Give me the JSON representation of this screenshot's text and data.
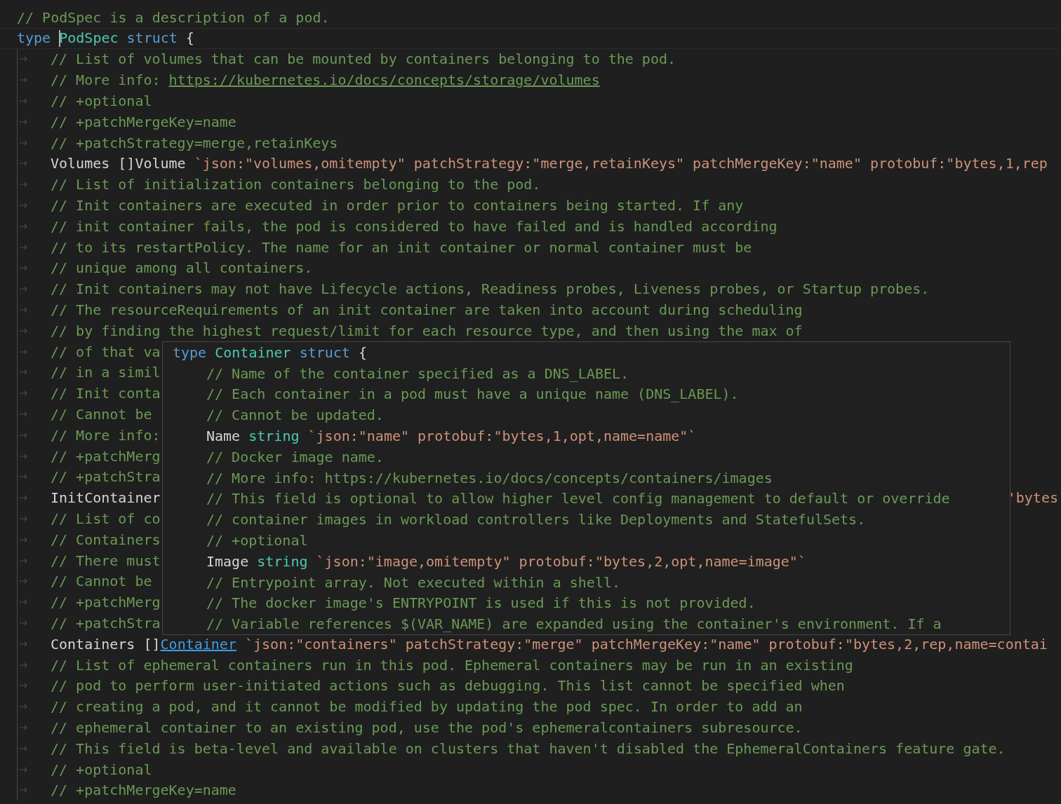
{
  "editor": {
    "lines": [
      {
        "indented": false,
        "tokens": [
          {
            "kind": "comment",
            "text": "// PodSpec is a description of a pod."
          }
        ]
      },
      {
        "indented": false,
        "active": true,
        "tokens": [
          {
            "kind": "keyword",
            "text": "type "
          },
          {
            "kind": "type",
            "text": "PodSpec",
            "caret": true
          },
          {
            "kind": "keyword",
            "text": " struct"
          },
          {
            "kind": "plain",
            "text": " {"
          }
        ]
      },
      {
        "indented": true,
        "tokens": [
          {
            "kind": "comment",
            "text": "// List of volumes that can be mounted by containers belonging to the pod."
          }
        ]
      },
      {
        "indented": true,
        "tokens": [
          {
            "kind": "comment",
            "text": "// More info: "
          },
          {
            "kind": "link",
            "text": "https://kubernetes.io/docs/concepts/storage/volumes"
          }
        ]
      },
      {
        "indented": true,
        "tokens": [
          {
            "kind": "comment",
            "text": "// +optional"
          }
        ]
      },
      {
        "indented": true,
        "tokens": [
          {
            "kind": "comment",
            "text": "// +patchMergeKey=name"
          }
        ]
      },
      {
        "indented": true,
        "tokens": [
          {
            "kind": "comment",
            "text": "// +patchStrategy=merge,retainKeys"
          }
        ]
      },
      {
        "indented": true,
        "tokens": [
          {
            "kind": "plain",
            "text": "Volumes []Volume "
          },
          {
            "kind": "string",
            "text": "`json:\"volumes,omitempty\" patchStrategy:\"merge,retainKeys\" patchMergeKey:\"name\" protobuf:\"bytes,1,rep"
          }
        ]
      },
      {
        "indented": true,
        "tokens": [
          {
            "kind": "comment",
            "text": "// List of initialization containers belonging to the pod."
          }
        ]
      },
      {
        "indented": true,
        "tokens": [
          {
            "kind": "comment",
            "text": "// Init containers are executed in order prior to containers being started. If any"
          }
        ]
      },
      {
        "indented": true,
        "tokens": [
          {
            "kind": "comment",
            "text": "// init container fails, the pod is considered to have failed and is handled according"
          }
        ]
      },
      {
        "indented": true,
        "tokens": [
          {
            "kind": "comment",
            "text": "// to its restartPolicy. The name for an init container or normal container must be"
          }
        ]
      },
      {
        "indented": true,
        "tokens": [
          {
            "kind": "comment",
            "text": "// unique among all containers."
          }
        ]
      },
      {
        "indented": true,
        "tokens": [
          {
            "kind": "comment",
            "text": "// Init containers may not have Lifecycle actions, Readiness probes, Liveness probes, or Startup probes."
          }
        ]
      },
      {
        "indented": true,
        "tokens": [
          {
            "kind": "comment",
            "text": "// The resourceRequirements of an init container are taken into account during scheduling"
          }
        ]
      },
      {
        "indented": true,
        "tokens": [
          {
            "kind": "comment",
            "text": "// by finding the highest request/limit for each resource type, and then using the max of"
          }
        ]
      },
      {
        "indented": true,
        "tokens": [
          {
            "kind": "comment",
            "text": "// of that va"
          }
        ]
      },
      {
        "indented": true,
        "tokens": [
          {
            "kind": "comment",
            "text": "// in a simil"
          }
        ]
      },
      {
        "indented": true,
        "tokens": [
          {
            "kind": "comment",
            "text": "// Init conta"
          }
        ]
      },
      {
        "indented": true,
        "tokens": [
          {
            "kind": "comment",
            "text": "// Cannot be"
          }
        ]
      },
      {
        "indented": true,
        "tokens": [
          {
            "kind": "comment",
            "text": "// More info:"
          }
        ]
      },
      {
        "indented": true,
        "tokens": [
          {
            "kind": "comment",
            "text": "// +patchMerg"
          }
        ]
      },
      {
        "indented": true,
        "tokens": [
          {
            "kind": "comment",
            "text": "// +patchStra"
          }
        ]
      },
      {
        "indented": true,
        "tokens": [
          {
            "kind": "plain",
            "text": "InitContainer"
          }
        ],
        "right_tokens": [
          {
            "kind": "string",
            "text": "'bytes"
          }
        ]
      },
      {
        "indented": true,
        "tokens": [
          {
            "kind": "comment",
            "text": "// List of co"
          }
        ]
      },
      {
        "indented": true,
        "tokens": [
          {
            "kind": "comment",
            "text": "// Containers"
          }
        ]
      },
      {
        "indented": true,
        "tokens": [
          {
            "kind": "comment",
            "text": "// There must"
          }
        ]
      },
      {
        "indented": true,
        "tokens": [
          {
            "kind": "comment",
            "text": "// Cannot be"
          }
        ]
      },
      {
        "indented": true,
        "tokens": [
          {
            "kind": "comment",
            "text": "// +patchMerg"
          }
        ]
      },
      {
        "indented": true,
        "tokens": [
          {
            "kind": "comment",
            "text": "// +patchStra"
          }
        ]
      },
      {
        "indented": true,
        "tokens": [
          {
            "kind": "plain",
            "text": "Containers []"
          },
          {
            "kind": "typelink",
            "text": "Container"
          },
          {
            "kind": "string",
            "text": " `json:\"containers\" patchStrategy:\"merge\" patchMergeKey:\"name\" protobuf:\"bytes,2,rep,name=contai"
          }
        ]
      },
      {
        "indented": true,
        "tokens": [
          {
            "kind": "comment",
            "text": "// List of ephemeral containers run in this pod. Ephemeral containers may be run in an existing"
          }
        ]
      },
      {
        "indented": true,
        "tokens": [
          {
            "kind": "comment",
            "text": "// pod to perform user-initiated actions such as debugging. This list cannot be specified when"
          }
        ]
      },
      {
        "indented": true,
        "tokens": [
          {
            "kind": "comment",
            "text": "// creating a pod, and it cannot be modified by updating the pod spec. In order to add an"
          }
        ]
      },
      {
        "indented": true,
        "tokens": [
          {
            "kind": "comment",
            "text": "// ephemeral container to an existing pod, use the pod's ephemeralcontainers subresource."
          }
        ]
      },
      {
        "indented": true,
        "tokens": [
          {
            "kind": "comment",
            "text": "// This field is beta-level and available on clusters that haven't disabled the EphemeralContainers feature gate."
          }
        ]
      },
      {
        "indented": true,
        "tokens": [
          {
            "kind": "comment",
            "text": "// +optional"
          }
        ]
      },
      {
        "indented": true,
        "tokens": [
          {
            "kind": "comment",
            "text": "// +patchMergeKey=name"
          }
        ]
      }
    ]
  },
  "hover_popup": {
    "lines": [
      {
        "indented": false,
        "tokens": [
          {
            "kind": "keyword",
            "text": "type "
          },
          {
            "kind": "type",
            "text": "Container"
          },
          {
            "kind": "keyword",
            "text": " struct"
          },
          {
            "kind": "plain",
            "text": " {"
          }
        ]
      },
      {
        "indented": true,
        "tokens": [
          {
            "kind": "comment",
            "text": "// Name of the container specified as a DNS_LABEL."
          }
        ]
      },
      {
        "indented": true,
        "tokens": [
          {
            "kind": "comment",
            "text": "// Each container in a pod must have a unique name (DNS_LABEL)."
          }
        ]
      },
      {
        "indented": true,
        "tokens": [
          {
            "kind": "comment",
            "text": "// Cannot be updated."
          }
        ]
      },
      {
        "indented": true,
        "tokens": [
          {
            "kind": "plain",
            "text": "Name "
          },
          {
            "kind": "type",
            "text": "string"
          },
          {
            "kind": "string",
            "text": " `json:\"name\" protobuf:\"bytes,1,opt,name=name\"`"
          }
        ]
      },
      {
        "indented": true,
        "tokens": [
          {
            "kind": "comment",
            "text": "// Docker image name."
          }
        ]
      },
      {
        "indented": true,
        "tokens": [
          {
            "kind": "comment",
            "text": "// More info: https://kubernetes.io/docs/concepts/containers/images"
          }
        ]
      },
      {
        "indented": true,
        "tokens": [
          {
            "kind": "comment",
            "text": "// This field is optional to allow higher level config management to default or override"
          }
        ]
      },
      {
        "indented": true,
        "tokens": [
          {
            "kind": "comment",
            "text": "// container images in workload controllers like Deployments and StatefulSets."
          }
        ]
      },
      {
        "indented": true,
        "tokens": [
          {
            "kind": "comment",
            "text": "// +optional"
          }
        ]
      },
      {
        "indented": true,
        "tokens": [
          {
            "kind": "plain",
            "text": "Image "
          },
          {
            "kind": "type",
            "text": "string"
          },
          {
            "kind": "string",
            "text": " `json:\"image,omitempty\" protobuf:\"bytes,2,opt,name=image\"`"
          }
        ]
      },
      {
        "indented": true,
        "tokens": [
          {
            "kind": "comment",
            "text": "// Entrypoint array. Not executed within a shell."
          }
        ]
      },
      {
        "indented": true,
        "tokens": [
          {
            "kind": "comment",
            "text": "// The docker image's ENTRYPOINT is used if this is not provided."
          }
        ]
      },
      {
        "indented": true,
        "tokens": [
          {
            "kind": "comment",
            "text": "// Variable references $(VAR_NAME) are expanded using the container's environment. If a"
          }
        ]
      }
    ]
  }
}
